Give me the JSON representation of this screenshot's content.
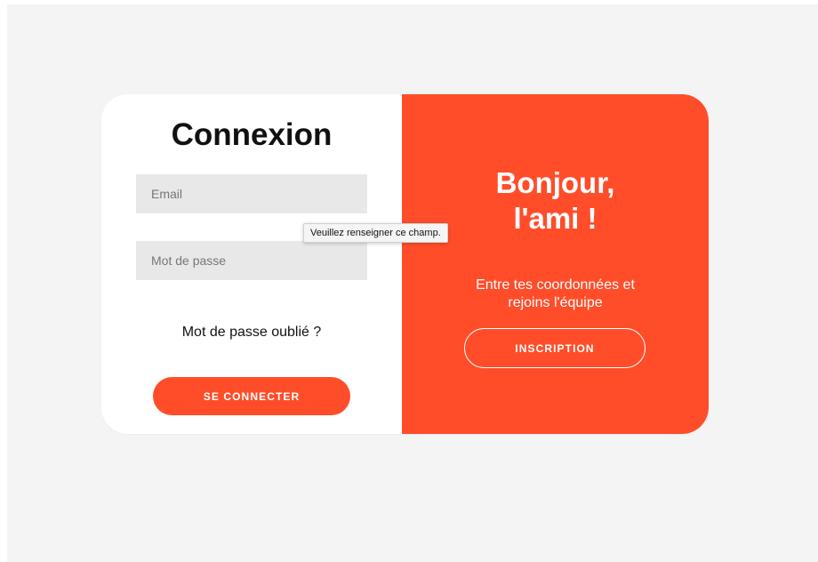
{
  "colors": {
    "accent": "#ff4d2a",
    "page_background": "#f4f4f4",
    "input_background": "#e8e8e8"
  },
  "login": {
    "title": "Connexion",
    "email_placeholder": "Email",
    "password_placeholder": "Mot de passe",
    "forgot_label": "Mot de passe oublié ?",
    "submit_label": "SE CONNECTER"
  },
  "signup": {
    "title_line1": "Bonjour,",
    "title_line2": "l'ami !",
    "text_line1": "Entre tes coordonnées et",
    "text_line2": "rejoins l'équipe",
    "button_label": "INSCRIPTION"
  },
  "tooltip": {
    "text": "Veuillez renseigner ce champ."
  }
}
